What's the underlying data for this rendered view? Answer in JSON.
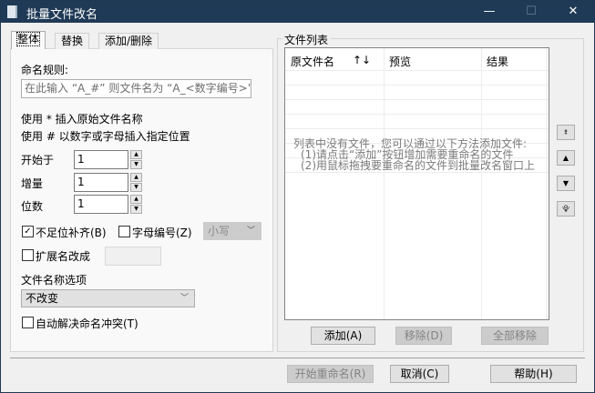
{
  "window": {
    "title": "批量文件改名",
    "minimize": "—",
    "maximize": "☐",
    "close": "✕"
  },
  "tabs": [
    {
      "label": "整体"
    },
    {
      "label": "替换"
    },
    {
      "label": "添加/删除"
    }
  ],
  "rules": {
    "label": "命名规则:",
    "placeholder": "在此输入 “A_#” 则文件名为 “A_<数字编号>”",
    "hint1": "使用 * 插入原始文件名称",
    "hint2": "使用 # 以数字或字母插入指定位置",
    "start_label": "开始于",
    "start_value": "1",
    "step_label": "增量",
    "step_value": "1",
    "digits_label": "位数",
    "digits_value": "1",
    "pad_label": "不足位补齐(B)",
    "pad_checked": true,
    "alpha_label": "字母编号(Z)",
    "alpha_checked": false,
    "case_value": "小写",
    "ext_label": "扩展名改成",
    "ext_checked": false,
    "ext_value": "",
    "name_opt_label": "文件名称选项",
    "name_opt_value": "不改变",
    "auto_label": "自动解决命名冲突(T)",
    "auto_checked": false
  },
  "file_list": {
    "title": "文件列表",
    "columns": [
      "原文件名",
      "预览",
      "结果"
    ],
    "sort_icon": "↑↓",
    "empty_lines": [
      "列表中没有文件，您可以通过以下方法添加文件:",
      "(1)请点击“添加”按钮增加需要重命名的文件",
      "(2)用鼠标拖拽要重命名的文件到批量改名窗口上"
    ],
    "add": "添加(A)",
    "remove": "移除(D)",
    "remove_all": "全部移除"
  },
  "side_buttons": {
    "top": "⯒",
    "up": "▲",
    "down": "▼",
    "bottom": "⯓"
  },
  "footer": {
    "start": "开始重命名(R)",
    "cancel": "取消(C)",
    "help": "帮助(H)"
  }
}
